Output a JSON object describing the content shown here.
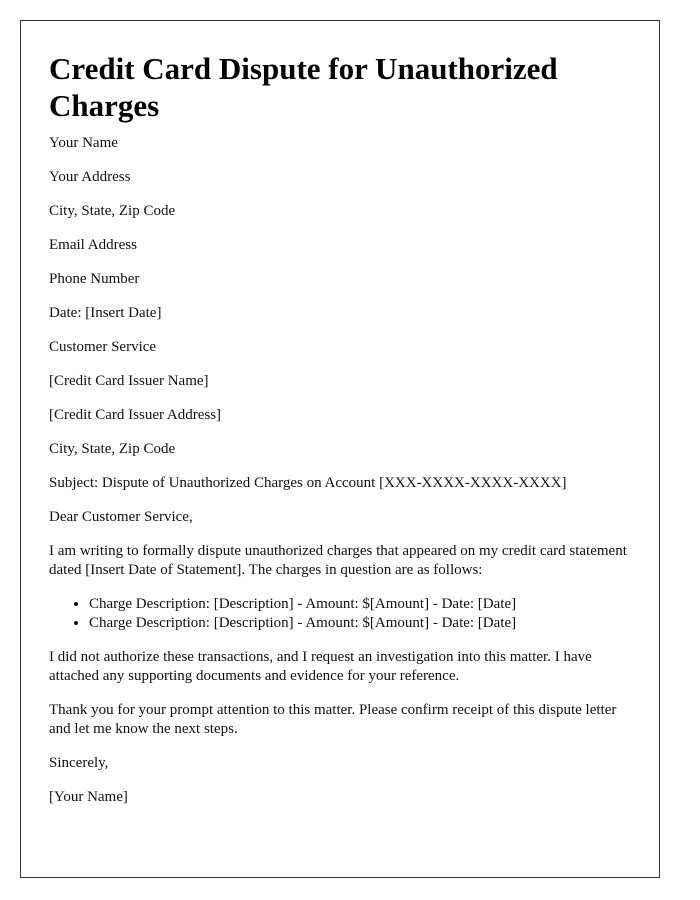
{
  "title": "Credit Card Dispute for Unauthorized Charges",
  "sender": {
    "name": "Your Name",
    "address": "Your Address",
    "city_state_zip": "City, State, Zip Code",
    "email": "Email Address",
    "phone": "Phone Number",
    "date": "Date: [Insert Date]"
  },
  "recipient": {
    "department": "Customer Service",
    "issuer_name": "[Credit Card Issuer Name]",
    "issuer_address": "[Credit Card Issuer Address]",
    "city_state_zip": "City, State, Zip Code"
  },
  "subject": "Subject: Dispute of Unauthorized Charges on Account [XXX-XXXX-XXXX-XXXX]",
  "salutation": "Dear Customer Service,",
  "body": {
    "intro": "I am writing to formally dispute unauthorized charges that appeared on my credit card statement dated [Insert Date of Statement]. The charges in question are as follows:",
    "charges": [
      "Charge Description: [Description] - Amount: $[Amount] - Date: [Date]",
      "Charge Description: [Description] - Amount: $[Amount] - Date: [Date]"
    ],
    "statement": "I did not authorize these transactions, and I request an investigation into this matter. I have attached any supporting documents and evidence for your reference.",
    "closing_request": "Thank you for your prompt attention to this matter. Please confirm receipt of this dispute letter and let me know the next steps."
  },
  "closing": "Sincerely,",
  "signature": "[Your Name]"
}
